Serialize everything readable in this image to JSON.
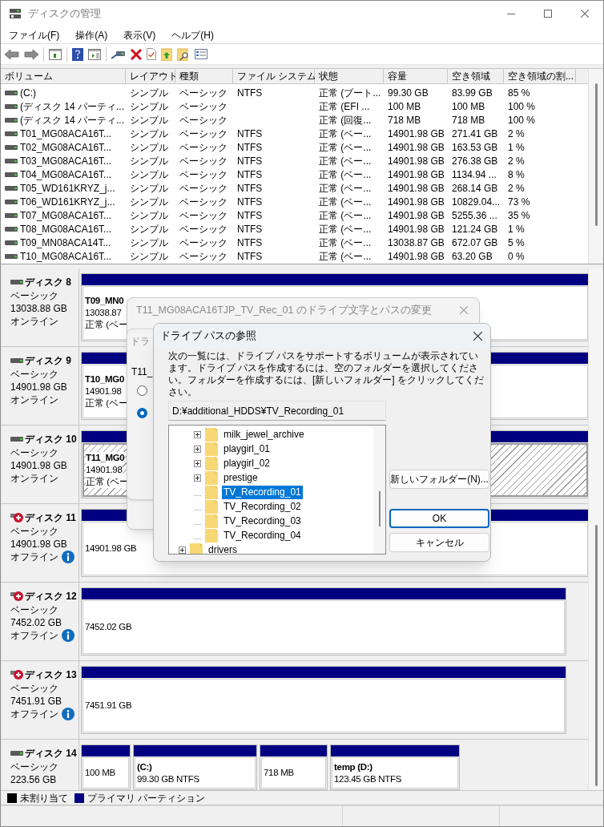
{
  "window": {
    "title": "ディスクの管理"
  },
  "menu": [
    "ファイル(F)",
    "操作(A)",
    "表示(V)",
    "ヘルプ(H)"
  ],
  "volume_table": {
    "columns": [
      "ボリューム",
      "レイアウト",
      "種類",
      "ファイル システム",
      "状態",
      "容量",
      "空き領域",
      "空き領域の割..."
    ],
    "rows": [
      {
        "cells": [
          "(C:)",
          "シンプル",
          "ベーシック",
          "NTFS",
          "正常 (ブート...",
          "99.30 GB",
          "83.99 GB",
          "85 %"
        ]
      },
      {
        "cells": [
          "(ディスク 14 パーティ...",
          "シンプル",
          "ベーシック",
          "",
          "正常 (EFI ...",
          "100 MB",
          "100 MB",
          "100 %"
        ]
      },
      {
        "cells": [
          "(ディスク 14 パーティ...",
          "シンプル",
          "ベーシック",
          "",
          "正常 (回復...",
          "718 MB",
          "718 MB",
          "100 %"
        ]
      },
      {
        "cells": [
          "T01_MG08ACA16T...",
          "シンプル",
          "ベーシック",
          "NTFS",
          "正常 (ベー...",
          "14901.98 GB",
          "271.41 GB",
          "2 %"
        ]
      },
      {
        "cells": [
          "T02_MG08ACA16T...",
          "シンプル",
          "ベーシック",
          "NTFS",
          "正常 (ベー...",
          "14901.98 GB",
          "163.53 GB",
          "1 %"
        ]
      },
      {
        "cells": [
          "T03_MG08ACA16T...",
          "シンプル",
          "ベーシック",
          "NTFS",
          "正常 (ベー...",
          "14901.98 GB",
          "276.38 GB",
          "2 %"
        ]
      },
      {
        "cells": [
          "T04_MG08ACA16T...",
          "シンプル",
          "ベーシック",
          "NTFS",
          "正常 (ベー...",
          "14901.98 GB",
          "1134.94 ...",
          "8 %"
        ]
      },
      {
        "cells": [
          "T05_WD161KRYZ_j...",
          "シンプル",
          "ベーシック",
          "NTFS",
          "正常 (ベー...",
          "14901.98 GB",
          "268.14 GB",
          "2 %"
        ]
      },
      {
        "cells": [
          "T06_WD161KRYZ_j...",
          "シンプル",
          "ベーシック",
          "NTFS",
          "正常 (ベー...",
          "14901.98 GB",
          "10829.04...",
          "73 %"
        ]
      },
      {
        "cells": [
          "T07_MG08ACA16T...",
          "シンプル",
          "ベーシック",
          "NTFS",
          "正常 (ベー...",
          "14901.98 GB",
          "5255.36 ...",
          "35 %"
        ]
      },
      {
        "cells": [
          "T08_MG08ACA16T...",
          "シンプル",
          "ベーシック",
          "NTFS",
          "正常 (ベー...",
          "14901.98 GB",
          "121.24 GB",
          "1 %"
        ]
      },
      {
        "cells": [
          "T09_MN08ACA14T...",
          "シンプル",
          "ベーシック",
          "NTFS",
          "正常 (ベー...",
          "13038.87 GB",
          "672.07 GB",
          "5 %"
        ]
      },
      {
        "cells": [
          "T10_MG08ACA16T...",
          "シンプル",
          "ベーシック",
          "NTFS",
          "正常 (ベー...",
          "14901.98 GB",
          "63.20 GB",
          "0 %"
        ]
      }
    ]
  },
  "disks": [
    {
      "name": "ディスク 8",
      "kind": "online",
      "lines": [
        "ベーシック",
        "13038.88 GB",
        "オンライン"
      ],
      "partitions": [
        {
          "title": "T09_MN0",
          "lines": [
            "13038.87",
            "正常 (ベー"
          ],
          "selected": false
        }
      ]
    },
    {
      "name": "ディスク 9",
      "kind": "online",
      "lines": [
        "ベーシック",
        "14901.98 GB",
        "オンライン"
      ],
      "partitions": [
        {
          "title": "T10_MG0",
          "lines": [
            "14901.98",
            "正常 (ベー"
          ],
          "selected": false
        }
      ]
    },
    {
      "name": "ディスク 10",
      "kind": "online",
      "lines": [
        "ベーシック",
        "14901.98 GB",
        "オンライン"
      ],
      "partitions": [
        {
          "title": "T11_MG0",
          "lines": [
            "14901.98",
            "正常 (ベー"
          ],
          "selected": true
        }
      ]
    },
    {
      "name": "ディスク 11",
      "kind": "offline",
      "lines": [
        "ベーシック",
        "14901.98 GB",
        "オフライン"
      ],
      "partitions": [
        {
          "lines": [
            "14901.98 GB"
          ],
          "selected": false
        }
      ]
    },
    {
      "name": "ディスク 12",
      "kind": "offline",
      "lines": [
        "ベーシック",
        "7452.02 GB",
        "オフライン"
      ],
      "partitions": [
        {
          "lines": [
            "7452.02 GB"
          ],
          "selected": false
        }
      ]
    },
    {
      "name": "ディスク 13",
      "kind": "offline",
      "lines": [
        "ベーシック",
        "7451.91 GB",
        "オフライン"
      ],
      "partitions": [
        {
          "lines": [
            "7451.91 GB"
          ],
          "selected": false
        }
      ]
    },
    {
      "name": "ディスク 14",
      "kind": "online",
      "lines": [
        "ベーシック",
        "223.56 GB"
      ],
      "partitions": [
        {
          "lines": [
            "100 MB"
          ],
          "selected": false
        },
        {
          "title": "(C:)",
          "lines": [
            "99.30 GB NTFS"
          ],
          "selected": false
        },
        {
          "lines": [
            "718 MB"
          ],
          "selected": false
        },
        {
          "title": "temp  (D:)",
          "lines": [
            "123.45 GB NTFS"
          ],
          "selected": false
        }
      ]
    }
  ],
  "legend": [
    {
      "label": "未割り当て",
      "color": "#000000"
    },
    {
      "label": "プライマリ パーティション",
      "color": "#000080"
    }
  ],
  "change_dialog": {
    "title": "T11_MG08ACA16TJP_TV_Rec_01 のドライブ文字とパスの変更",
    "panel_title": "ドラ",
    "volume_label": "T11_",
    "radios": [
      {
        "selected": false
      },
      {
        "selected": true
      }
    ]
  },
  "browse_dialog": {
    "title": "ドライブ パスの参照",
    "description": "次の一覧には、ドライブ パスをサポートするボリュームが表示されています。ドライブ パスを作成するには、空のフォルダーを選択してください。フォルダーを作成するには、[新しいフォルダー] をクリックしてください。",
    "path": "D:¥additional_HDDS¥TV_Recording_01",
    "tree": [
      {
        "children": [
          {
            "label": "milk_jewel_archive",
            "collapsed": true,
            "selected": false
          },
          {
            "label": "playgirl_01",
            "collapsed": true,
            "selected": false
          },
          {
            "label": "playgirl_02",
            "collapsed": true,
            "selected": false
          },
          {
            "label": "prestige",
            "collapsed": true,
            "selected": false
          },
          {
            "label": "TV_Recording_01",
            "collapsed": false,
            "selected": true
          },
          {
            "label": "TV_Recording_02",
            "collapsed": false,
            "selected": false
          },
          {
            "label": "TV_Recording_03",
            "collapsed": false,
            "selected": false
          },
          {
            "label": "TV_Recording_04",
            "collapsed": false,
            "selected": false
          }
        ]
      },
      {
        "label": "drivers",
        "collapsed": true,
        "selected": false
      }
    ],
    "buttons": [
      {
        "label": "新しいフォルダー(N)...",
        "default": false
      },
      {
        "label": "OK",
        "default": true
      },
      {
        "label": "キャンセル",
        "default": false
      }
    ]
  }
}
